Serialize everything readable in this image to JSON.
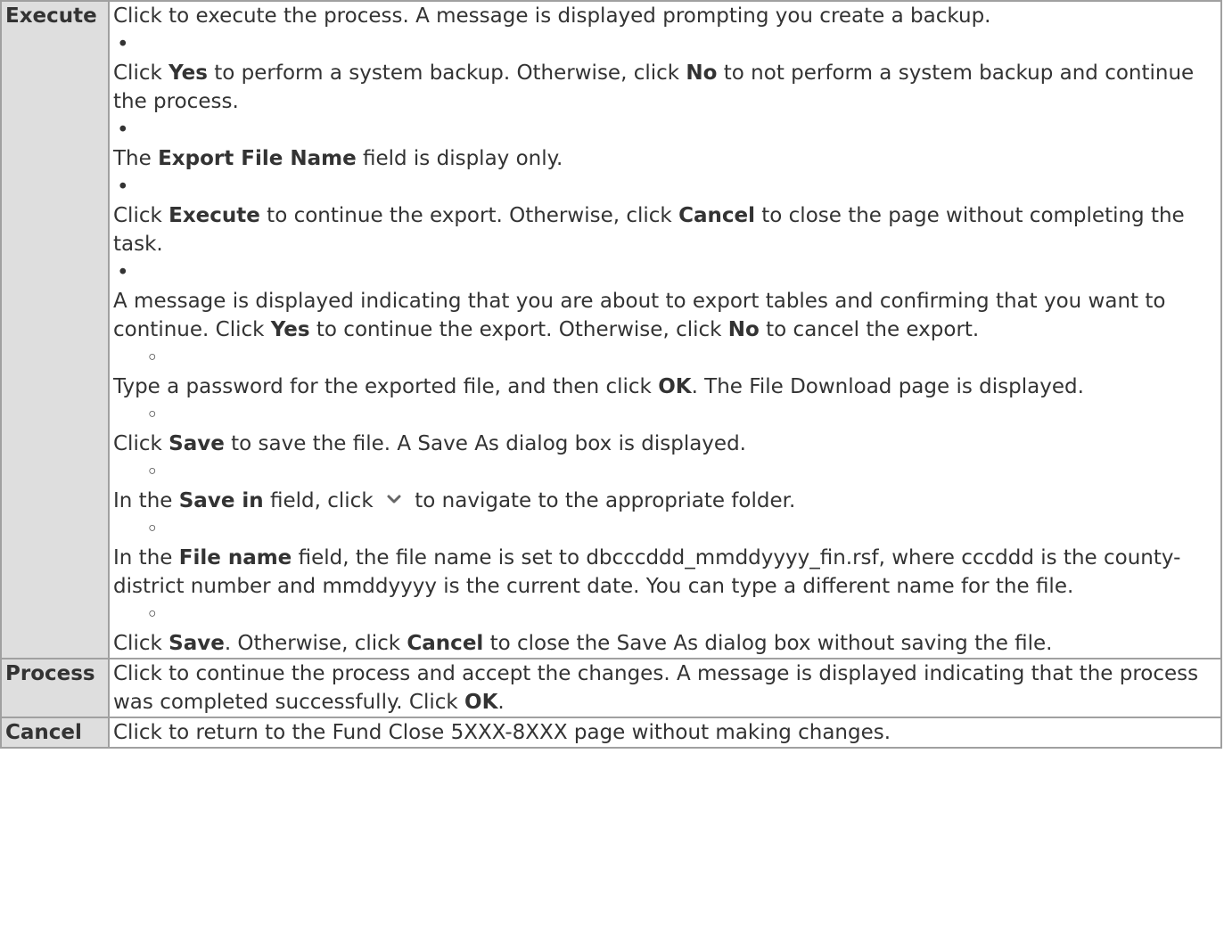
{
  "rows": [
    {
      "label": "Execute",
      "intro": "Click to execute the process. A message is displayed prompting you create a backup.",
      "bullet_marker": "•",
      "circle_marker": "◦",
      "steps": [
        {
          "t1": "Click ",
          "b1": "Yes",
          "t2": " to perform a system backup. Otherwise, click ",
          "b2": "No",
          "t3": " to not perform a system backup and continue the process."
        },
        {
          "t1": "The ",
          "b1": "Export File Name",
          "t2": " field is display only."
        },
        {
          "t1": "Click ",
          "b1": "Execute",
          "t2": " to continue the export. Otherwise, click ",
          "b2": "Cancel",
          "t3": " to close the page without completing the task."
        },
        {
          "t1": "A message is displayed indicating that you are about to export tables and confirming that you want to continue. Click ",
          "b1": "Yes",
          "t2": " to continue the export. Otherwise, click ",
          "b2": "No",
          "t3": " to cancel the export."
        }
      ],
      "substeps": [
        {
          "t1": "Type a password for the exported file, and then click ",
          "b1": "OK",
          "t2": ". The File Download page is displayed."
        },
        {
          "t1": "Click ",
          "b1": "Save",
          "t2": " to save the file. A Save As dialog box is displayed."
        },
        {
          "t1": "In the ",
          "b1": "Save in",
          "t2": " field, click ",
          "icon": "chevron-down-icon",
          "t3": " to navigate to the appropriate folder."
        },
        {
          "t1": "In the ",
          "b1": "File name",
          "t2": " field, the file name is set to dbcccddd_mmddyyyy_fin.rsf, where cccddd is the county-district number and mmddyyyy is the current date. You can type a different name for the file."
        },
        {
          "t1": "Click ",
          "b1": "Save",
          "t2": ". Otherwise, click ",
          "b2": "Cancel",
          "t3": " to close the Save As dialog box without saving the file."
        }
      ]
    },
    {
      "label": "Process",
      "t1": "Click to continue the process and accept the changes. A message is displayed indicating that the process was completed successfully. Click ",
      "b1": "OK",
      "t2": "."
    },
    {
      "label": "Cancel",
      "t1": "Click to return to the Fund Close 5XXX-8XXX page without making changes."
    }
  ]
}
